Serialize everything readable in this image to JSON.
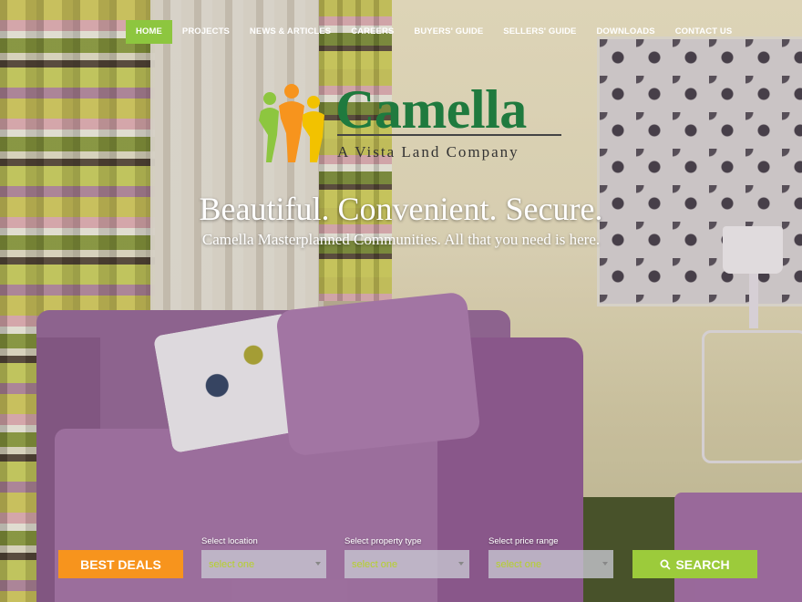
{
  "nav": {
    "items": [
      {
        "label": "HOME",
        "active": true
      },
      {
        "label": "PROJECTS"
      },
      {
        "label": "NEWS & ARTICLES"
      },
      {
        "label": "CAREERS"
      },
      {
        "label": "BUYERS' GUIDE"
      },
      {
        "label": "SELLERS' GUIDE"
      },
      {
        "label": "DOWNLOADS"
      },
      {
        "label": "CONTACT US"
      }
    ],
    "active_color": "#8dc63f"
  },
  "logo": {
    "wordmark": "Camella",
    "tagline": "A Vista Land Company",
    "brand_color": "#1f7a3e"
  },
  "hero": {
    "headline": "Beautiful. Convenient. Secure.",
    "subheadline": "Camella Masterplanned Communities. All that you need is here."
  },
  "search": {
    "deals_label": "BEST DEALS",
    "location": {
      "label": "Select location",
      "value": "select one"
    },
    "property_type": {
      "label": "Select property type",
      "value": "select one"
    },
    "price_range": {
      "label": "Select price range",
      "value": "select one"
    },
    "search_label": "SEARCH",
    "search_icon": "search-icon",
    "deals_color": "#f7941d",
    "search_color": "#9ccb3b"
  }
}
